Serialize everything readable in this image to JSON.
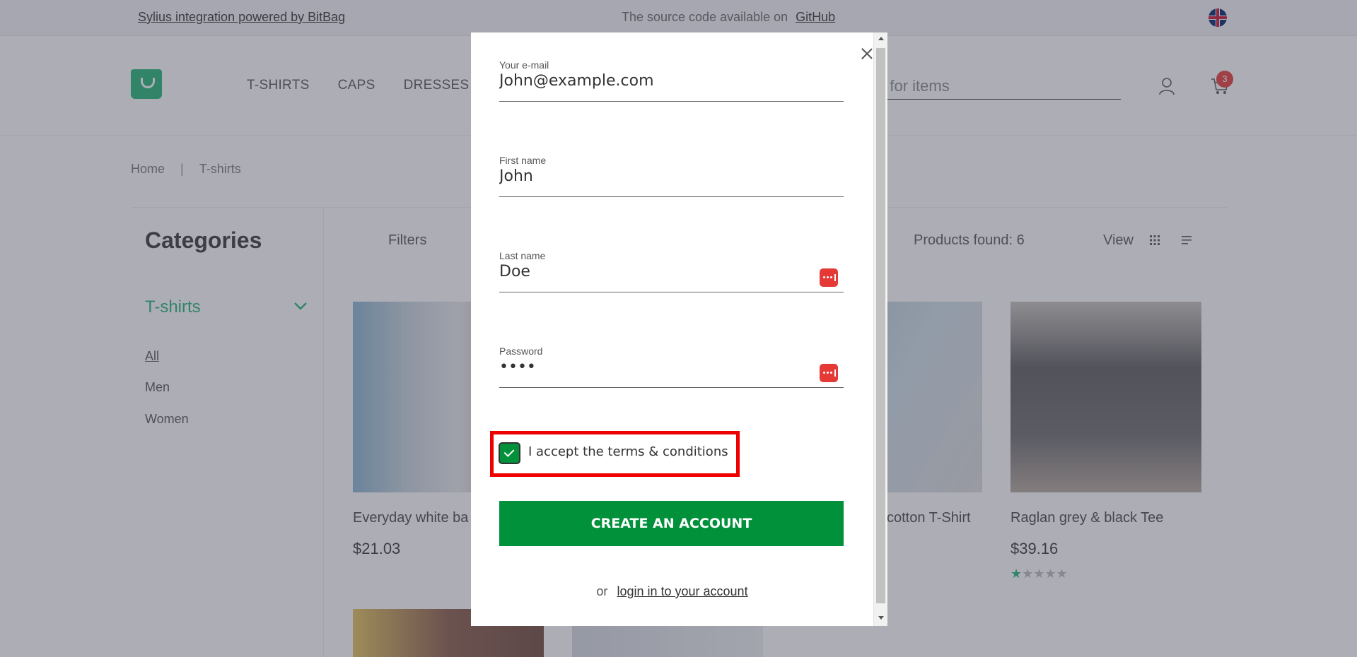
{
  "topbar": {
    "promo": "Sylius integration powered by BitBag",
    "source_text": "The source code available on",
    "source_link": "GitHub"
  },
  "header": {
    "nav": [
      "T-SHIRTS",
      "CAPS",
      "DRESSES"
    ],
    "search_placeholder": "n for items",
    "cart_count": "3"
  },
  "breadcrumb": {
    "home": "Home",
    "separator": "|",
    "current": "T-shirts"
  },
  "listing": {
    "categories_title": "Categories",
    "filters_label": "Filters",
    "products_found": "Products found:  6",
    "view_label": "View"
  },
  "sidebar": {
    "category": "T-shirts",
    "links": [
      "All",
      "Men",
      "Women"
    ]
  },
  "products": [
    {
      "name": "Everyday white ba",
      "price": "$21.03"
    },
    {
      "name": "cotton T-Shirt",
      "price": ""
    },
    {
      "name": "Raglan grey & black Tee",
      "price": "$39.16",
      "rating": 1,
      "rating_max": 5
    }
  ],
  "modal": {
    "email": {
      "label": "Your e-mail",
      "value": "John@example.com"
    },
    "first_name": {
      "label": "First name",
      "value": "John"
    },
    "last_name": {
      "label": "Last name",
      "value": "Doe"
    },
    "password": {
      "label": "Password",
      "value": "••••"
    },
    "terms_label": "I accept the terms & conditions",
    "terms_checked": true,
    "create_button": "CREATE AN ACCOUNT",
    "login_prefix": "or",
    "login_link": "login in to your account"
  },
  "colors": {
    "brand_green": "#00913a",
    "accent_green": "#22b573",
    "highlight_red": "#ee0000",
    "badge_red": "#e53935"
  }
}
